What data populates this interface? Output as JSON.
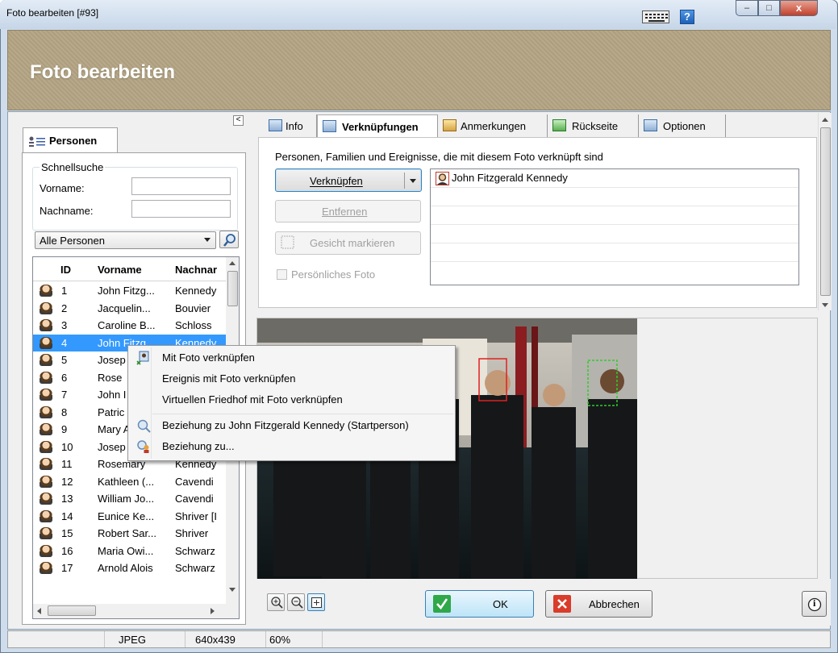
{
  "window": {
    "title": "Foto bearbeiten [#93]",
    "help_label": "?",
    "minimize_label": "–",
    "maximize_label": "□",
    "close_label": "x"
  },
  "header": {
    "title": "Foto bearbeiten"
  },
  "left_panel": {
    "tab_label": "Personen",
    "collapse_label": "<",
    "quick_search": {
      "legend": "Schnellsuche",
      "first_name_label": "Vorname:",
      "first_name_value": "",
      "last_name_label": "Nachname:",
      "last_name_value": ""
    },
    "filter": {
      "selected": "Alle Personen"
    },
    "grid": {
      "headers": {
        "id": "ID",
        "first_name": "Vorname",
        "last_name": "Nachnar"
      },
      "rows": [
        {
          "id": "1",
          "first": "John Fitzg...",
          "last": "Kennedy"
        },
        {
          "id": "2",
          "first": "Jacquelin...",
          "last": "Bouvier"
        },
        {
          "id": "3",
          "first": "Caroline B...",
          "last": "Schloss"
        },
        {
          "id": "4",
          "first": "John Fitzg...",
          "last": "Kennedy",
          "selected": true
        },
        {
          "id": "5",
          "first": "Josep",
          "last": ""
        },
        {
          "id": "6",
          "first": "Rose",
          "last": ""
        },
        {
          "id": "7",
          "first": "John I",
          "last": ""
        },
        {
          "id": "8",
          "first": "Patric",
          "last": ""
        },
        {
          "id": "9",
          "first": "Mary A",
          "last": ""
        },
        {
          "id": "10",
          "first": "Josep",
          "last": ""
        },
        {
          "id": "11",
          "first": "Rosemary",
          "last": "Kennedy"
        },
        {
          "id": "12",
          "first": "Kathleen (...",
          "last": "Cavendi"
        },
        {
          "id": "13",
          "first": "William Jo...",
          "last": "Cavendi"
        },
        {
          "id": "14",
          "first": "Eunice Ke...",
          "last": "Shriver [I"
        },
        {
          "id": "15",
          "first": "Robert Sar...",
          "last": "Shriver"
        },
        {
          "id": "16",
          "first": "Maria Owi...",
          "last": "Schwarz"
        },
        {
          "id": "17",
          "first": "Arnold Alois",
          "last": "Schwarz"
        }
      ]
    }
  },
  "tabs": [
    {
      "label": "Info"
    },
    {
      "label": "Verknüpfungen",
      "active": true
    },
    {
      "label": "Anmerkungen"
    },
    {
      "label": "Rückseite"
    },
    {
      "label": "Optionen"
    }
  ],
  "links_tab": {
    "description": "Personen, Familien und Ereignisse, die mit diesem Foto verknüpft sind",
    "link_button": "Verknüpfen",
    "remove_button": "Entfernen",
    "mark_face_button": "Gesicht markieren",
    "personal_photo_label": "Persönliches Foto",
    "linked_items": [
      "John Fitzgerald Kennedy"
    ]
  },
  "context_menu": {
    "items": [
      "Mit Foto verknüpfen",
      "Ereignis mit Foto verknüpfen",
      "Virtuellen Friedhof mit Foto verknüpfen",
      "Beziehung zu John Fitzgerald Kennedy (Startperson)",
      "Beziehung zu..."
    ]
  },
  "bottom": {
    "ok_label": "OK",
    "cancel_label": "Abbrechen",
    "info_label": "i"
  },
  "statusbar": {
    "format": "JPEG",
    "dimensions": "640x439",
    "zoom": "60%"
  },
  "colors": {
    "accent": "#3399ff",
    "header_bg": "#b3a483",
    "face_link": "#e02020",
    "face_unlinked": "#2ecc2e"
  }
}
